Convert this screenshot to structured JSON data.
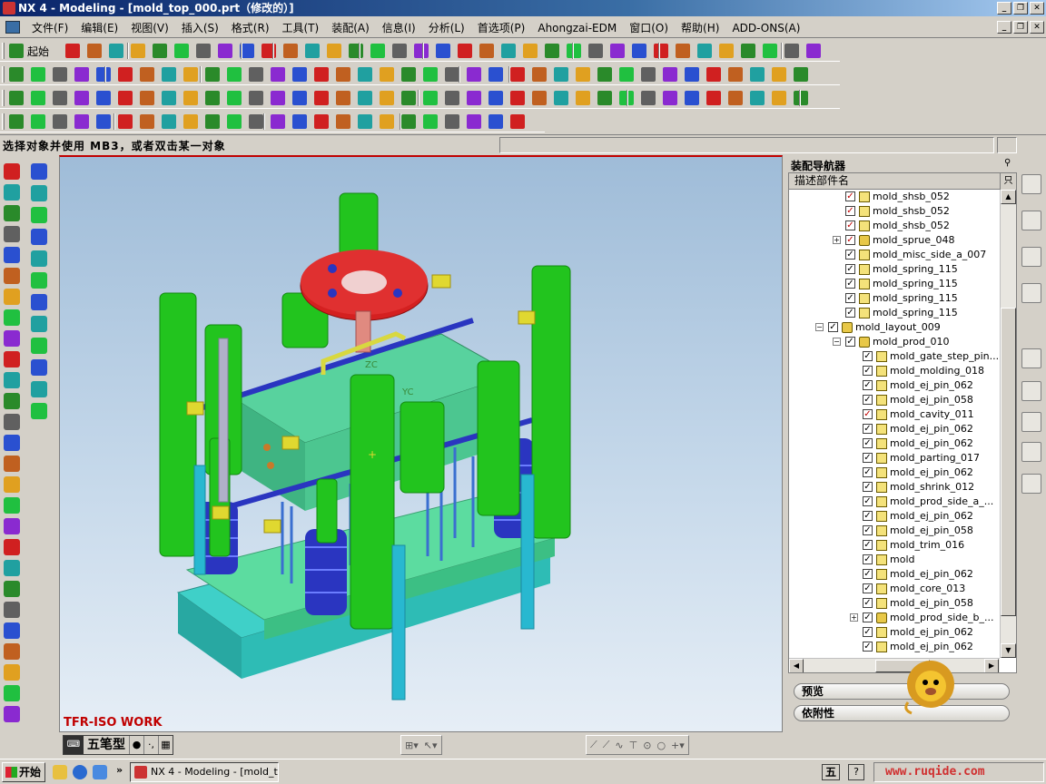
{
  "window": {
    "title": "NX 4 - Modeling - [mold_top_000.prt（修改的）]",
    "buttons": [
      "_",
      "❐",
      "✕"
    ]
  },
  "menu": {
    "items": [
      "文件(F)",
      "编辑(E)",
      "视图(V)",
      "插入(S)",
      "格式(R)",
      "工具(T)",
      "装配(A)",
      "信息(I)",
      "分析(L)",
      "首选项(P)",
      "Ahongzai-EDM",
      "窗口(O)",
      "帮助(H)",
      "ADD-ONS(A)"
    ]
  },
  "toolbar": {
    "start_label": "起始"
  },
  "cue": {
    "text": "选择对象并使用 MB3，或者双击某一对象"
  },
  "viewport": {
    "label": "TFR-ISO WORK",
    "axis_zc": "ZC",
    "axis_yc": "YC"
  },
  "statusbar": {
    "ime_name": "五笔型"
  },
  "navigator": {
    "title": "装配导航器",
    "column_header": "描述部件名",
    "rows": [
      {
        "label": "mold_shsb_052",
        "checked": true,
        "red": true
      },
      {
        "label": "mold_shsb_052",
        "checked": true,
        "red": true
      },
      {
        "label": "mold_shsb_052",
        "checked": true,
        "red": true
      },
      {
        "label": "mold_sprue_048",
        "checked": true,
        "red": true
      },
      {
        "label": "mold_misc_side_a_007",
        "checked": true,
        "red": false
      },
      {
        "label": "mold_spring_115",
        "checked": true,
        "red": false
      },
      {
        "label": "mold_spring_115",
        "checked": true,
        "red": false
      },
      {
        "label": "mold_spring_115",
        "checked": true,
        "red": false
      },
      {
        "label": "mold_spring_115",
        "checked": true,
        "red": false
      },
      {
        "label": "mold_layout_009",
        "checked": true,
        "red": false
      },
      {
        "label": "mold_prod_010",
        "checked": true,
        "red": false
      },
      {
        "label": "mold_gate_step_pin...",
        "checked": true,
        "red": false
      },
      {
        "label": "mold_molding_018",
        "checked": true,
        "red": false
      },
      {
        "label": "mold_ej_pin_062",
        "checked": true,
        "red": false
      },
      {
        "label": "mold_ej_pin_058",
        "checked": true,
        "red": false
      },
      {
        "label": "mold_cavity_011",
        "checked": true,
        "red": true
      },
      {
        "label": "mold_ej_pin_062",
        "checked": true,
        "red": false
      },
      {
        "label": "mold_ej_pin_062",
        "checked": true,
        "red": false
      },
      {
        "label": "mold_parting_017",
        "checked": true,
        "red": false
      },
      {
        "label": "mold_ej_pin_062",
        "checked": true,
        "red": false
      },
      {
        "label": "mold_shrink_012",
        "checked": true,
        "red": false
      },
      {
        "label": "mold_prod_side_a_...",
        "checked": true,
        "red": false
      },
      {
        "label": "mold_ej_pin_062",
        "checked": true,
        "red": false
      },
      {
        "label": "mold_ej_pin_058",
        "checked": true,
        "red": false
      },
      {
        "label": "mold_trim_016",
        "checked": true,
        "red": false
      },
      {
        "label": "mold",
        "checked": true,
        "red": false
      },
      {
        "label": "mold_ej_pin_062",
        "checked": true,
        "red": false
      },
      {
        "label": "mold_core_013",
        "checked": true,
        "red": false
      },
      {
        "label": "mold_ej_pin_058",
        "checked": true,
        "red": false
      },
      {
        "label": "mold_prod_side_b_...",
        "checked": true,
        "red": false
      },
      {
        "label": "mold_ej_pin_062",
        "checked": true,
        "red": false
      },
      {
        "label": "mold_ej_pin_062",
        "checked": true,
        "red": false
      }
    ],
    "panel_preview": "预览",
    "panel_dependencies": "依附性"
  },
  "taskbar": {
    "start": "开始",
    "task_item": "NX 4 - Modeling - [mold_t...",
    "tray_icon": "五",
    "help": "?",
    "watermark": "www.ruqide.com"
  }
}
